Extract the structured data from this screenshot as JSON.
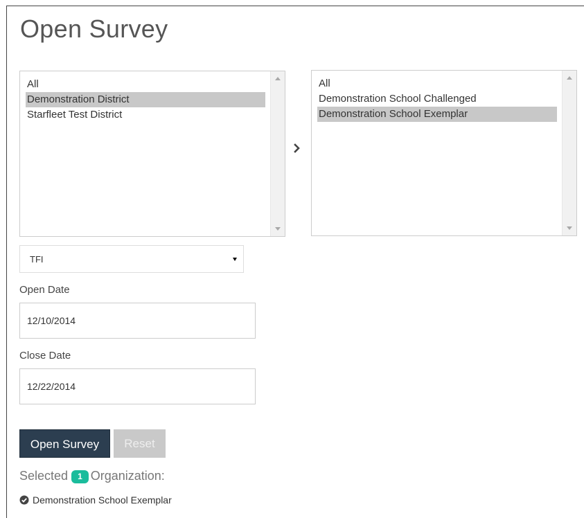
{
  "page": {
    "title": "Open Survey"
  },
  "districts": {
    "items": [
      {
        "label": "All",
        "selected": false
      },
      {
        "label": "Demonstration District",
        "selected": true
      },
      {
        "label": "Starfleet Test District",
        "selected": false
      }
    ]
  },
  "move_button": {
    "icon": "chevron-right-icon"
  },
  "schools": {
    "items": [
      {
        "label": "All",
        "selected": false
      },
      {
        "label": "Demonstration School Challenged",
        "selected": false
      },
      {
        "label": "Demonstration School Exemplar",
        "selected": true
      }
    ]
  },
  "survey_type": {
    "value": "TFI"
  },
  "open_date": {
    "label": "Open Date",
    "value": "12/10/2014"
  },
  "close_date": {
    "label": "Close Date",
    "value": "12/22/2014"
  },
  "actions": {
    "open_label": "Open Survey",
    "reset_label": "Reset"
  },
  "selection": {
    "prefix": "Selected",
    "count": "1",
    "suffix": "Organization:",
    "organizations": [
      "Demonstration School Exemplar"
    ],
    "icon": "check-circle-icon"
  },
  "colors": {
    "primary_button": "#2c3e50",
    "badge": "#1abc9c",
    "selected_item": "#c8c8c8"
  }
}
